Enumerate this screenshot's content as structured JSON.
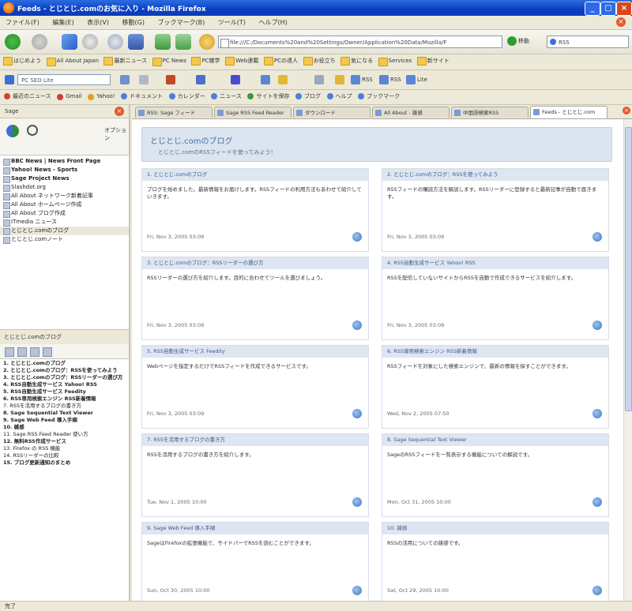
{
  "window": {
    "title": "Feeds - とじとじ.comのお気に入り - Mozilla Firefox",
    "minimize": "_",
    "maximize": "□",
    "close": "×"
  },
  "menu": [
    "ファイル(F)",
    "編集(E)",
    "表示(V)",
    "移動(G)",
    "ブックマーク(B)",
    "ツール(T)",
    "ヘルプ(H)"
  ],
  "nav": {
    "url": "file:///C:/Documents%20and%20Settings/Owner/Application%20Data/Mozilla/F",
    "go_label": "移動",
    "search_value": "RSS"
  },
  "bookmarks": [
    "はじめよう",
    "All About Japan",
    "最新ニュース",
    "PC News",
    "PC雑学",
    "Web連載",
    "PCの達人",
    "お役立ち",
    "気になる",
    "Services",
    "新サイト"
  ],
  "toolbar3": {
    "input_value": "PC SEO Lite",
    "labels": [
      "RSS",
      "RSS",
      "Lite"
    ]
  },
  "toolbar4": [
    "最近のニュース",
    "Gmail",
    "Yahoo!",
    "ドキュメント",
    "カレンダー",
    "ニュース",
    "サイトを保存",
    "ブログ",
    "ヘルプ",
    "ブックマーク"
  ],
  "sidebar": {
    "title": "Sage",
    "close": "×",
    "options_label": "オプション",
    "feeds": [
      {
        "label": "BBC News | News Front Page",
        "bold": true
      },
      {
        "label": "Yahoo! News - Sports",
        "bold": true
      },
      {
        "label": "Sage Project News",
        "bold": true
      },
      {
        "label": "Slashdot.org",
        "bold": false
      },
      {
        "label": "All About ネットワーク新着記事",
        "bold": false
      },
      {
        "label": "All About ホームページ作成",
        "bold": false
      },
      {
        "label": "All About ブログ作成",
        "bold": false
      },
      {
        "label": "ITmedia ニュース",
        "bold": false
      },
      {
        "label": "とじとじ.comのブログ",
        "bold": false,
        "selected": true
      },
      {
        "label": "とじとじ.comノート",
        "bold": false
      }
    ],
    "split_title": "とじとじ.comのブログ",
    "items": [
      {
        "label": "1. とじとじ.comのブログ",
        "bold": true
      },
      {
        "label": "2. とじとじ.comのブログ：RSSを使ってみよう",
        "bold": true
      },
      {
        "label": "3. とじとじ.comのブログ：RSSリーダーの選び方",
        "bold": true
      },
      {
        "label": "4. RSS自動生成サービス Yahoo! RSS",
        "bold": true
      },
      {
        "label": "5. RSS自動生成サービス Feedity",
        "bold": true
      },
      {
        "label": "6. RSS専用検索エンジン RSS新着情報",
        "bold": true
      },
      {
        "label": "7. RSSを活用するブログの書き方",
        "bold": false
      },
      {
        "label": "8. Sage Sequential Text Viewer",
        "bold": true
      },
      {
        "label": "9. Sage Web Feed 導入手順",
        "bold": true
      },
      {
        "label": "10. 雑感",
        "bold": true
      },
      {
        "label": "11. Sage RSS Feed Reader 使い方",
        "bold": false
      },
      {
        "label": "12. 無料RSS作成サービス",
        "bold": true
      },
      {
        "label": "13. Firefox の RSS 機能",
        "bold": false
      },
      {
        "label": "14. RSSリーダーの比較",
        "bold": false
      },
      {
        "label": "15. ブログ更新通知のまとめ",
        "bold": true
      }
    ]
  },
  "tabs": [
    {
      "label": "RSS: Sage フィード",
      "active": false
    },
    {
      "label": "Sage RSS Feed Reader",
      "active": false
    },
    {
      "label": "ダウンロード",
      "active": false
    },
    {
      "label": "All About - 雑感",
      "active": false
    },
    {
      "label": "中国語検索RSS",
      "active": false
    },
    {
      "label": "Feeds - とじとじ.com",
      "active": true
    }
  ],
  "tab_close": "×",
  "main": {
    "title": "とじとじ.comのブログ",
    "subtitle": "とじとじ.comのRSSフィードを使ってみよう！",
    "cards": [
      {
        "title": "1. とじとじ.comのブログ",
        "body": "ブログを始めました。最新情報をお届けします。RSSフィードの利用方法もあわせて紹介していきます。",
        "date": "Fri, Nov 3, 2005 03:09"
      },
      {
        "title": "2. とじとじ.comのブログ：RSSを使ってみよう",
        "body": "RSSフィードの購読方法を解説します。RSSリーダーに登録すると最新記事が自動で届きます。",
        "date": "Fri, Nov 3, 2005 03:09"
      },
      {
        "title": "3. とじとじ.comのブログ：RSSリーダーの選び方",
        "body": "RSSリーダーの選び方を紹介します。目的に合わせてツールを選びましょう。",
        "date": "Fri, Nov 3, 2005 03:09"
      },
      {
        "title": "4. RSS自動生成サービス Yahoo! RSS",
        "body": "RSSを配信していないサイトからRSSを自動で作成できるサービスを紹介します。",
        "date": "Fri, Nov 3, 2005 03:09"
      },
      {
        "title": "5. RSS自動生成サービス Feedity",
        "body": "Webページを指定するだけでRSSフィードを作成できるサービスです。",
        "date": "Fri, Nov 3, 2005 03:09"
      },
      {
        "title": "6. RSS専用検索エンジン RSS新着情報",
        "body": "RSSフィードを対象にした検索エンジンで、最新の情報を探すことができます。",
        "date": "Wed, Nov 2, 2005 07:50"
      },
      {
        "title": "7. RSSを活用するブログの書き方",
        "body": "RSSを活用するブログの書き方を紹介します。",
        "date": "Tue, Nov 1, 2005 10:00"
      },
      {
        "title": "8. Sage Sequential Text Viewer",
        "body": "SageのRSSフィードを一覧表示する機能についての解説です。",
        "date": "Mon, Oct 31, 2005 10:00"
      },
      {
        "title": "9. Sage Web Feed 導入手順",
        "body": "SageはFirefoxの拡張機能で、サイドバーでRSSを読むことができます。",
        "date": "Sun, Oct 30, 2005 10:00"
      },
      {
        "title": "10. 雑感",
        "body": "RSSの活用についての雑感です。",
        "date": "Sat, Oct 29, 2005 10:00"
      }
    ]
  },
  "status": "完了"
}
